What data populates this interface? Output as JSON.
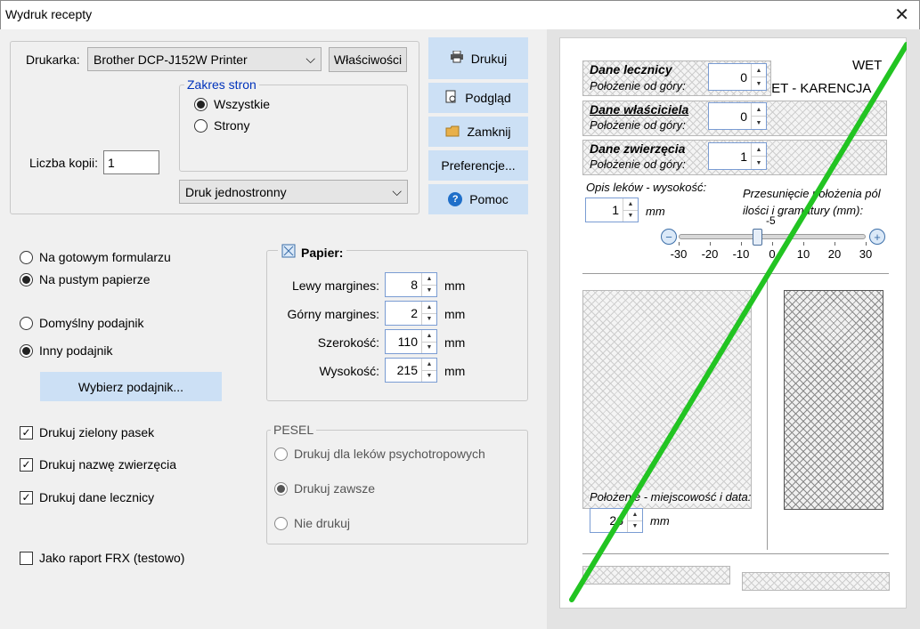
{
  "window": {
    "title": "Wydruk recepty",
    "close_icon": "close-icon"
  },
  "printer": {
    "label": "Drukarka:",
    "selected": "Brother DCP-J152W Printer",
    "properties_button": "Właściwości",
    "range_group": "Zakres stron",
    "range_all": "Wszystkie",
    "range_pages": "Strony",
    "copies_label": "Liczba kopii:",
    "copies_value": "1",
    "duplex_selected": "Druk jednostronny"
  },
  "actions": {
    "print": "Drukuj",
    "preview": "Podgląd",
    "close": "Zamknij",
    "preferences": "Preferencje...",
    "help": "Pomoc"
  },
  "form_mode": {
    "ready_form": "Na gotowym formularzu",
    "blank_paper": "Na pustym papierze",
    "default_tray": "Domyślny podajnik",
    "other_tray": "Inny podajnik",
    "choose_tray_button": "Wybierz podajnik..."
  },
  "options": {
    "green_bar": "Drukuj zielony pasek",
    "animal_name": "Drukuj nazwę zwierzęcia",
    "vet_data": "Drukuj dane lecznicy",
    "frx_report": "Jako raport FRX (testowo)"
  },
  "paper": {
    "title": "Papier:",
    "unit": "mm",
    "left_margin_label": "Lewy margines:",
    "left_margin": "8",
    "top_margin_label": "Górny margines:",
    "top_margin": "2",
    "width_label": "Szerokość:",
    "width": "110",
    "height_label": "Wysokość:",
    "height": "215"
  },
  "pesel": {
    "title": "PESEL",
    "psychotropic": "Drukuj dla leków psychotropowych",
    "always": "Drukuj zawsze",
    "never": "Nie drukuj"
  },
  "preview": {
    "header_text_1": "WET",
    "header_text_2": "WET - KARENCJA",
    "vet_data_title": "Dane lecznicy",
    "vet_data_pos_label": "Położenie od góry:",
    "vet_data_pos": "0",
    "owner_title": "Dane właściciela",
    "owner_pos_label": "Położenie od góry:",
    "owner_pos": "0",
    "animal_title": "Dane zwierzęcia",
    "animal_pos_label": "Położenie od góry:",
    "animal_pos": "1",
    "drugs_height_label": "Opis leków - wysokość:",
    "drugs_height": "1",
    "unit": "mm",
    "shift_label_1": "Przesunięcie położenia pól",
    "shift_label_2": "ilości i gramatury (mm):",
    "shift_value": "-5",
    "shift_level": -5,
    "shift_min": -30,
    "shift_max": 30,
    "slider_ticks": [
      "-30",
      "-20",
      "-10",
      "0",
      "10",
      "20",
      "30"
    ],
    "location_label": "Położenie - miejscowość i data:",
    "location_value": "26",
    "accent_line_color": "#22c422"
  }
}
